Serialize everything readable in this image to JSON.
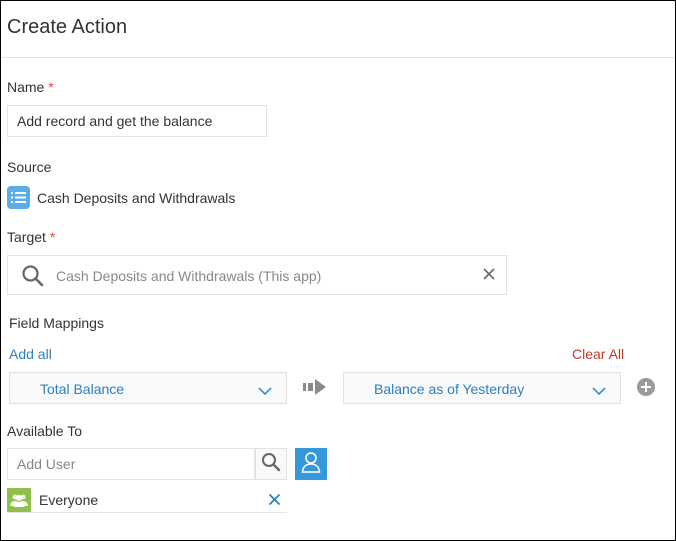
{
  "header": {
    "title": "Create Action"
  },
  "name_field": {
    "label": "Name",
    "required_mark": "*",
    "value": "Add record and get the balance"
  },
  "source": {
    "label": "Source",
    "app_name": "Cash Deposits and Withdrawals",
    "icon": "list-app-icon"
  },
  "target": {
    "label": "Target",
    "required_mark": "*",
    "value": "Cash Deposits and Withdrawals (This app)",
    "search_icon": "search-icon",
    "clear_icon": "close-icon"
  },
  "field_mappings": {
    "label": "Field Mappings",
    "add_all": "Add all",
    "clear_all": "Clear All",
    "rows": [
      {
        "source_field": "Total Balance",
        "target_field": "Balance as of Yesterday"
      }
    ]
  },
  "available_to": {
    "label": "Available To",
    "placeholder": "Add User",
    "entities": [
      {
        "name": "Everyone",
        "icon": "group-icon"
      }
    ]
  },
  "colors": {
    "link": "#2e7fc1",
    "danger": "#c0392b",
    "required": "#e74c3c",
    "primary_button": "#3498db",
    "group_icon": "#8fbf4c",
    "app_icon": "#5aaee8"
  }
}
